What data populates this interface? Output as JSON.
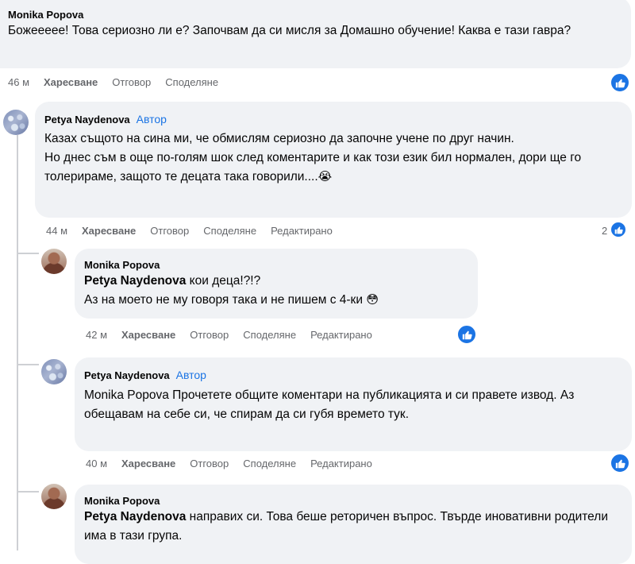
{
  "comments": [
    {
      "author": "Monika Popova",
      "text": "Божеееее! Това сериозно ли е? Започвам да си мисля за Домашно обучение! Каква е тази гавра?",
      "time": "46 м",
      "like": "Харесване",
      "reply": "Отговор",
      "share": "Споделяне"
    },
    {
      "author": "Petya Naydenova",
      "badge": "Автор",
      "text1": "Казах същото на сина ми, че обмислям сериозно да започне учене по друг начин.",
      "text2": "Но днес съм в още по-голям шок след коментарите и как този език бил нормален, дори ще го толерираме, защото те децата така говорили....",
      "emoji": "😭",
      "time": "44 м",
      "like": "Харесване",
      "reply": "Отговор",
      "share": "Споделяне",
      "edited": "Редактирано",
      "reactions": "2"
    },
    {
      "author": "Monika Popova",
      "mention": "Petya Naydenova",
      "text1": " кои деца!?!?",
      "text2": "Аз на моето не му говоря така и не пишем с 4-ки",
      "emoji": "😳",
      "time": "42 м",
      "like": "Харесване",
      "reply": "Отговор",
      "share": "Споделяне",
      "edited": "Редактирано"
    },
    {
      "author": "Petya Naydenova",
      "badge": "Автор",
      "text": "Monika Popova Прочетете общите коментари на публикацията и си правете извод. Аз обещавам на себе си, че спирам да си губя времето тук.",
      "time": "40 м",
      "like": "Харесване",
      "reply": "Отговор",
      "share": "Споделяне",
      "edited": "Редактирано"
    },
    {
      "author": "Monika Popova",
      "mention": "Petya Naydenova",
      "text": " направих си. Това беше реторичен въпрос. Твърде иновативни родители има в тази група."
    }
  ],
  "icons": {
    "like": "thumbs-up-icon",
    "accent": "#1b74e4"
  }
}
